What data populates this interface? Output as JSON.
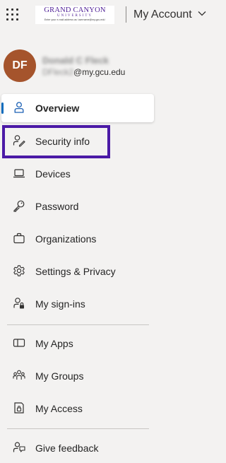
{
  "header": {
    "app_launcher_icon": "waffle-icon",
    "logo": {
      "line1": "GRAND CANYON",
      "line2": "UNIVERSITY",
      "line3": "Enter your e-mail address as 'username@my.gcu.edu'"
    },
    "title": "My Account",
    "title_icon": "chevron-down-icon"
  },
  "profile": {
    "initials": "DF",
    "name": "Donald C Fleck",
    "email_user": "DFleck2",
    "email_domain": "@my.gcu.edu"
  },
  "nav": {
    "items": [
      {
        "label": "Overview",
        "icon": "person-icon",
        "active": true
      },
      {
        "label": "Security info",
        "icon": "person-key-icon",
        "highlighted": true
      },
      {
        "label": "Devices",
        "icon": "laptop-icon"
      },
      {
        "label": "Password",
        "icon": "key-icon"
      },
      {
        "label": "Organizations",
        "icon": "briefcase-icon"
      },
      {
        "label": "Settings & Privacy",
        "icon": "gear-icon"
      },
      {
        "label": "My sign-ins",
        "icon": "person-lock-icon"
      },
      {
        "label": "My Apps",
        "icon": "apps-icon"
      },
      {
        "label": "My Groups",
        "icon": "people-icon"
      },
      {
        "label": "My Access",
        "icon": "access-icon"
      },
      {
        "label": "Give feedback",
        "icon": "feedback-icon"
      }
    ]
  },
  "colors": {
    "background": "#f3f2f1",
    "active_indicator": "#0f6cbd",
    "highlight_border": "#4b1aa6",
    "avatar": "#a5542c",
    "brand_purple": "#522398"
  }
}
